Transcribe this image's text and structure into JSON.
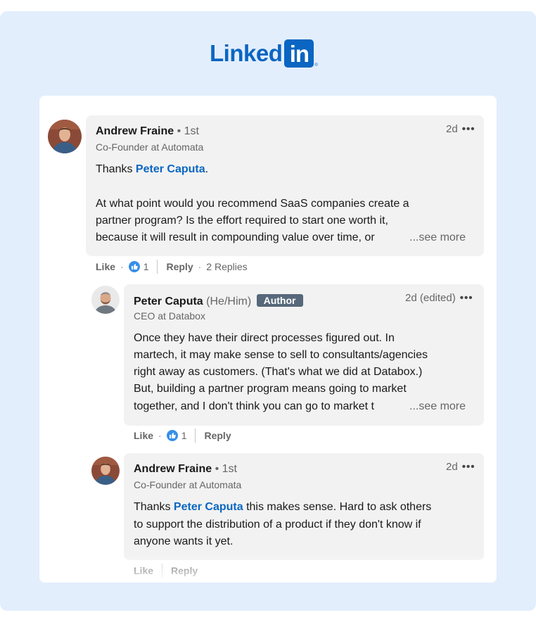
{
  "logo": {
    "word": "Linked",
    "box": "in",
    "reg": "®"
  },
  "comments": [
    {
      "name": "Andrew Fraine",
      "degree": "• 1st",
      "headline": "Co-Founder at Automata",
      "time": "2d",
      "more": "•••",
      "lines": [
        {
          "pre": "Thanks ",
          "mention": "Peter Caputa",
          "post": "."
        },
        {
          "text": "At what point would you recommend SaaS companies create a"
        },
        {
          "text": "partner program? Is the effort required to start one worth it,"
        },
        {
          "text": "because it will result in compounding value over time, or"
        }
      ],
      "see_more": "...see more",
      "actions": {
        "like": "Like",
        "reactions": "1",
        "reply": "Reply",
        "replies": "2 Replies"
      }
    },
    {
      "name": "Peter Caputa",
      "pronouns": "(He/Him)",
      "badge": "Author",
      "headline": "CEO at Databox",
      "time": "2d (edited)",
      "more": "•••",
      "lines": [
        {
          "text": "Once they have their direct processes figured out. In"
        },
        {
          "text": "martech, it may make sense to sell to consultants/agencies"
        },
        {
          "text": "right away as customers. (That's what we did at Databox.)"
        },
        {
          "text": "But, building a partner program means going to market"
        },
        {
          "text": "together, and I don't think you can go to market t"
        }
      ],
      "see_more": "...see more",
      "actions": {
        "like": "Like",
        "reactions": "1",
        "reply": "Reply"
      }
    },
    {
      "name": "Andrew Fraine",
      "degree": "• 1st",
      "headline": "Co-Founder at Automata",
      "time": "2d",
      "more": "•••",
      "lines": [
        {
          "pre": "Thanks ",
          "mention": "Peter Caputa",
          "post": " this makes sense. Hard to ask others"
        },
        {
          "text": "to support the distribution of a product if they don't know if"
        },
        {
          "text": "anyone wants it yet."
        }
      ],
      "actions": {
        "like": "Like",
        "reply": "Reply"
      }
    }
  ],
  "colors": {
    "brand": "#0a66c2",
    "background": "#e3eefc",
    "bubble": "#f2f2f2",
    "author_badge": "#56687a",
    "reaction": "#378fe9"
  },
  "icons": [
    "like-reaction-icon",
    "more-options-icon",
    "avatar-andrew-fraine",
    "avatar-peter-caputa"
  ]
}
